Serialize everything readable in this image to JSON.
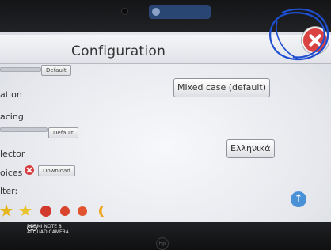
{
  "window": {
    "title": "Configuration"
  },
  "rows": {
    "font_size": {
      "default_label": "Default"
    },
    "case": {
      "label": "ation",
      "value": "Mixed case (default)"
    },
    "spacing": {
      "label": "acing",
      "default_label": "Default"
    },
    "language": {
      "label": "lector",
      "value": "Ελληνικά"
    },
    "voices": {
      "label": "oices",
      "download_label": "Download"
    },
    "filter": {
      "label": "lter:"
    }
  },
  "icons": {
    "close": "close-icon",
    "scroll_up": "arrow-up-icon",
    "voice_remove": "remove-icon"
  },
  "watermark": {
    "line1": "REDMI NOTE 8",
    "line2": "AI QUAD CAMERA"
  },
  "colors": {
    "close": "#d94342",
    "accent": "#4a90d6",
    "annotation": "#1f4fd1",
    "sticker": "#d8452c"
  }
}
